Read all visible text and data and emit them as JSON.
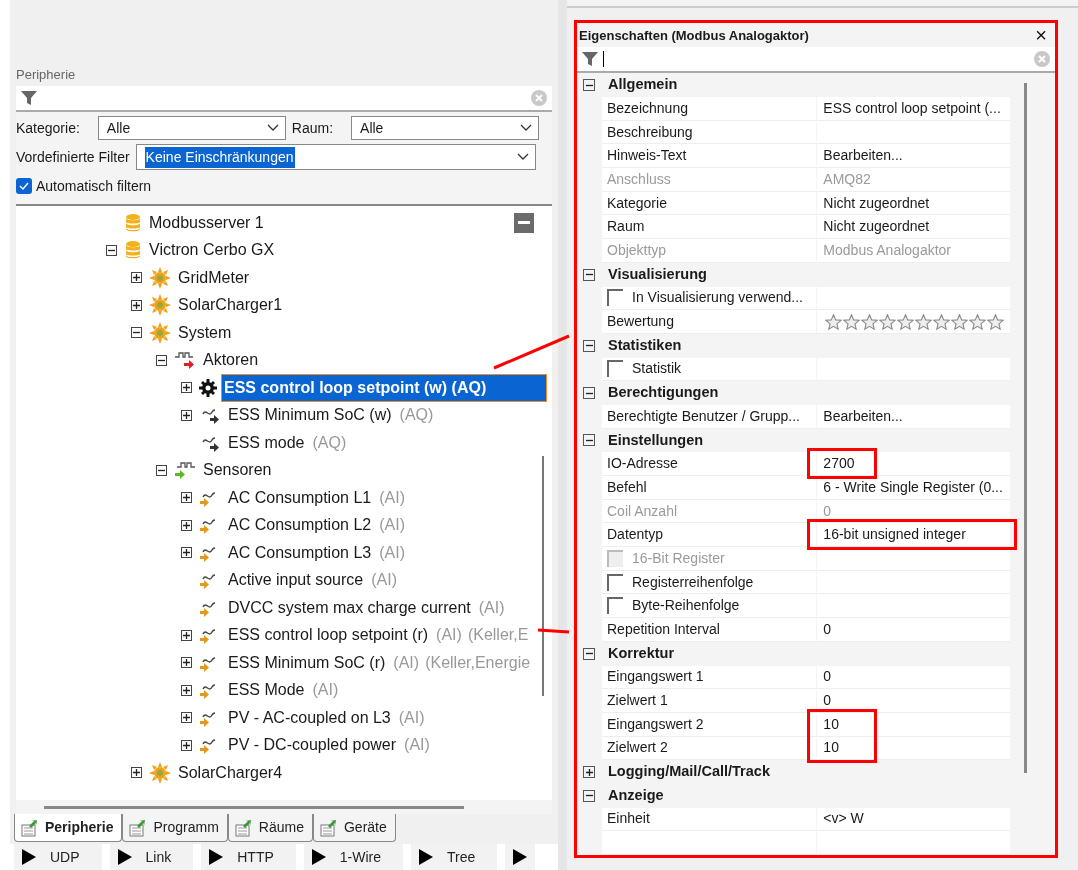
{
  "left_panel": {
    "title": "Peripherie",
    "filter": {
      "category_label": "Kategorie:",
      "category_value": "Alle",
      "room_label": "Raum:",
      "room_value": "Alle",
      "preset_label": "Vordefinierte Filter",
      "preset_value": "Keine Einschränkungen",
      "auto_label": "Automatisch filtern",
      "auto_checked": true
    },
    "tree": [
      {
        "label": "Modbusserver 1",
        "kind": "server",
        "selected": false
      },
      {
        "label": "Victron Cerbo GX",
        "kind": "server",
        "expanded": true,
        "selected": false,
        "children": [
          {
            "label": "GridMeter",
            "kind": "device",
            "expanded": false,
            "selected": false
          },
          {
            "label": "SolarCharger1",
            "kind": "device",
            "expanded": false,
            "selected": false
          },
          {
            "label": "System",
            "kind": "device",
            "expanded": true,
            "selected": false,
            "children": [
              {
                "label": "Aktoren",
                "kind": "actor_group",
                "expanded": true,
                "selected": false,
                "children": [
                  {
                    "label": "ESS control loop setpoint (w) (AQ)",
                    "kind": "gear",
                    "expanded": false,
                    "selected": true
                  },
                  {
                    "label": "ESS Minimum SoC (w)",
                    "type": "(AQ)",
                    "kind": "actor",
                    "expanded": false,
                    "selected": false
                  },
                  {
                    "label": "ESS mode",
                    "type": "(AQ)",
                    "kind": "actor",
                    "selected": false
                  }
                ]
              },
              {
                "label": "Sensoren",
                "kind": "sensor_group",
                "expanded": true,
                "selected": false,
                "children": [
                  {
                    "label": "AC Consumption L1",
                    "type": "(AI)",
                    "kind": "sensor",
                    "expanded": false,
                    "selected": false
                  },
                  {
                    "label": "AC Consumption L2",
                    "type": "(AI)",
                    "kind": "sensor",
                    "expanded": false,
                    "selected": false
                  },
                  {
                    "label": "AC Consumption L3",
                    "type": "(AI)",
                    "kind": "sensor",
                    "expanded": false,
                    "selected": false
                  },
                  {
                    "label": "Active input source",
                    "type": "(AI)",
                    "kind": "sensor",
                    "selected": false
                  },
                  {
                    "label": "DVCC system max charge current",
                    "type": "(AI)",
                    "kind": "sensor",
                    "selected": false
                  },
                  {
                    "label": "ESS control loop setpoint (r)",
                    "type": "(AI)",
                    "note": "(Keller,E",
                    "kind": "sensor",
                    "expanded": false,
                    "selected": false
                  },
                  {
                    "label": "ESS Minimum SoC (r)",
                    "type": "(AI)",
                    "note": "(Keller,Energie",
                    "kind": "sensor",
                    "expanded": false,
                    "selected": false
                  },
                  {
                    "label": "ESS Mode",
                    "type": "(AI)",
                    "kind": "sensor",
                    "expanded": false,
                    "selected": false
                  },
                  {
                    "label": "PV - AC-coupled on L3",
                    "type": "(AI)",
                    "kind": "sensor",
                    "expanded": false,
                    "selected": false
                  },
                  {
                    "label": "PV - DC-coupled power",
                    "type": "(AI)",
                    "kind": "sensor",
                    "expanded": false,
                    "selected": false
                  }
                ]
              }
            ]
          },
          {
            "label": "SolarCharger4",
            "kind": "device",
            "expanded": false,
            "selected": false
          }
        ]
      }
    ],
    "tabs": [
      {
        "label": "Peripherie",
        "selected": true
      },
      {
        "label": "Programm",
        "selected": false
      },
      {
        "label": "Räume",
        "selected": false
      },
      {
        "label": "Geräte",
        "selected": false
      }
    ],
    "buttons": [
      "UDP",
      "Link",
      "HTTP",
      "1-Wire",
      "Tree"
    ]
  },
  "properties": {
    "title": "Eigenschaften (Modbus Analogaktor)",
    "close": "×",
    "categories": [
      {
        "label": "Allgemein",
        "expanded": true,
        "rows": [
          {
            "kind": "text",
            "label": "Bezeichnung",
            "value": "ESS control loop setpoint (...",
            "disabled": false,
            "highlighted": false
          },
          {
            "kind": "text",
            "label": "Beschreibung",
            "disabled": false,
            "highlighted": false
          },
          {
            "kind": "text",
            "label": "Hinweis-Text",
            "value": "Bearbeiten...",
            "disabled": false,
            "highlighted": false
          },
          {
            "kind": "text",
            "label": "Anschluss",
            "value": "AMQ82",
            "disabled": true,
            "highlighted": false
          },
          {
            "kind": "text",
            "label": "Kategorie",
            "value": "Nicht zugeordnet",
            "disabled": false,
            "highlighted": false
          },
          {
            "kind": "text",
            "label": "Raum",
            "value": "Nicht zugeordnet",
            "disabled": false,
            "highlighted": false
          },
          {
            "kind": "text",
            "label": "Objekttyp",
            "value": "Modbus Analogaktor",
            "disabled": true,
            "highlighted": false
          }
        ]
      },
      {
        "label": "Visualisierung",
        "expanded": true,
        "rows": [
          {
            "kind": "checkbox",
            "label": "In Visualisierung verwend...",
            "checked": false,
            "disabled": false
          },
          {
            "kind": "stars",
            "label": "Bewertung",
            "stars": 0
          }
        ]
      },
      {
        "label": "Statistiken",
        "expanded": true,
        "rows": [
          {
            "kind": "checkbox",
            "label": "Statistik",
            "checked": false,
            "disabled": false
          }
        ]
      },
      {
        "label": "Berechtigungen",
        "expanded": true,
        "rows": [
          {
            "kind": "text",
            "label": "Berechtigte Benutzer / Grupp...",
            "value": "Bearbeiten...",
            "disabled": false,
            "highlighted": false
          }
        ]
      },
      {
        "label": "Einstellungen",
        "expanded": true,
        "rows": [
          {
            "kind": "text",
            "label": "IO-Adresse",
            "value": "2700",
            "disabled": false,
            "highlighted": true
          },
          {
            "kind": "text",
            "label": "Befehl",
            "value": "6 - Write Single Register (0...",
            "disabled": false,
            "highlighted": false
          },
          {
            "kind": "text",
            "label": "Coil Anzahl",
            "value": "0",
            "disabled": true,
            "highlighted": false
          },
          {
            "kind": "text",
            "label": "Datentyp",
            "value": "16-bit unsigned integer",
            "disabled": false,
            "highlighted": true
          },
          {
            "kind": "checkbox",
            "label": "16-Bit Register",
            "checked": false,
            "disabled": true
          },
          {
            "kind": "checkbox",
            "label": "Registerreihenfolge",
            "checked": false,
            "disabled": false
          },
          {
            "kind": "checkbox",
            "label": "Byte-Reihenfolge",
            "checked": false,
            "disabled": false
          },
          {
            "kind": "text",
            "label": "Repetition Interval",
            "value": "0",
            "disabled": false,
            "highlighted": false
          }
        ]
      },
      {
        "label": "Korrektur",
        "expanded": true,
        "rows": [
          {
            "kind": "text",
            "label": "Eingangswert 1",
            "value": "0",
            "disabled": false,
            "highlighted": false
          },
          {
            "kind": "text",
            "label": "Zielwert 1",
            "value": "0",
            "disabled": false,
            "highlighted": false
          },
          {
            "kind": "text",
            "label": "Eingangswert 2",
            "value": "10",
            "disabled": false,
            "highlighted": true
          },
          {
            "kind": "text",
            "label": "Zielwert 2",
            "value": "10",
            "disabled": false,
            "highlighted": true
          }
        ]
      },
      {
        "label": "Logging/Mail/Call/Track",
        "expanded": false
      },
      {
        "label": "Anzeige",
        "expanded": true,
        "rows": [
          {
            "kind": "text",
            "label": "Einheit",
            "value": "<v> W",
            "disabled": false,
            "highlighted": false
          }
        ]
      }
    ]
  }
}
